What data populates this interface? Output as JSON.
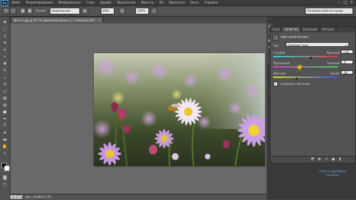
{
  "app": {
    "logo": "Ps"
  },
  "menu": [
    "Файл",
    "Редактирование",
    "Изображение",
    "Слои",
    "Шрифт",
    "Выделение",
    "Фильтр",
    "3D",
    "Просмотр",
    "Окно",
    "Справка"
  ],
  "options_bar": {
    "mode_label": "Режим:",
    "mode_value": "Нормальный",
    "opacity_value": "40%",
    "flow_value": "100%",
    "workspace_value": "Основная рабочая среда"
  },
  "document": {
    "tab_title": "фото 1.jpg @ 16,7% (Цветовой баланс 1, Слой-маска/8) *",
    "zoom": "16,67%",
    "info": "Док: 28,8M/57,7M"
  },
  "properties_panel": {
    "tabs": [
      "Свой",
      "Свойства",
      "Операции",
      "История"
    ],
    "active_tab_index": 1,
    "title": "Цветовой баланс",
    "tone_label": "Тон:",
    "tone_value": "Средние тона",
    "sliders": [
      {
        "left": "Голубой",
        "right": "Красный",
        "value": "+16",
        "position": 0.58,
        "gradient": [
          "#29d6e8",
          "#e03a3a"
        ]
      },
      {
        "left": "Пурпурный",
        "right": "Зеленый",
        "value": "-9",
        "position": 0.45,
        "gradient": [
          "#d63ad6",
          "#3ad64a"
        ]
      },
      {
        "left": "Желтый",
        "right": "Синий",
        "value": "-26",
        "position": 0.36,
        "gradient": [
          "#e6e02a",
          "#3a55e6"
        ]
      }
    ],
    "preserve_label": "Сохранить свечение",
    "preserve_checked": true
  },
  "watermark": {
    "line1": "Ольга Шубина",
    "line2": "Photoshop"
  },
  "colors": {
    "app_bg": "#4a4a4a",
    "canvas_bg": "#696969",
    "panel_bg": "#535353"
  }
}
